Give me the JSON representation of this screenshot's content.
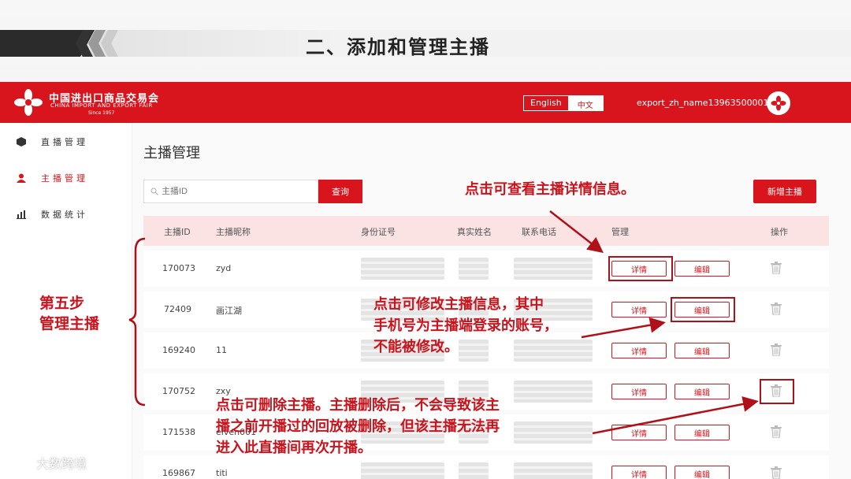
{
  "slide": {
    "title": "二、添加和管理主播"
  },
  "header": {
    "logo_cn": "中国进出口商品交易会",
    "logo_en": "CHINA IMPORT AND EXPORT FAIR",
    "logo_since": "Since 1957",
    "lang_en": "English",
    "lang_zh": "中文",
    "username": "export_zh_name13963500001"
  },
  "sidebar": {
    "items": [
      {
        "label": "直播管理",
        "icon": "cube-icon"
      },
      {
        "label": "主播管理",
        "icon": "user-icon",
        "active": true
      },
      {
        "label": "数据统计",
        "icon": "bar-chart-icon"
      }
    ]
  },
  "main": {
    "title": "主播管理",
    "search_placeholder": "主播ID",
    "query_label": "查询",
    "add_label": "新增主播",
    "columns": [
      "主播ID",
      "主播昵称",
      "身份证号",
      "真实姓名",
      "联系电话",
      "管理",
      "操作"
    ],
    "detail_label": "详情",
    "edit_label": "编辑",
    "rows": [
      {
        "id": "170073",
        "nickname": "zyd"
      },
      {
        "id": "72409",
        "nickname": "画江湖"
      },
      {
        "id": "169240",
        "nickname": "11"
      },
      {
        "id": "170752",
        "nickname": "zxy"
      },
      {
        "id": "171538",
        "nickname": "elven001"
      },
      {
        "id": "169867",
        "nickname": "titi"
      }
    ]
  },
  "annotations": {
    "detail_note": "点击可查看主播详情信息。",
    "edit_note_1": "点击可修改主播信息，其中",
    "edit_note_2": "手机号为主播端登录的账号，",
    "edit_note_3": "不能被修改。",
    "delete_note_1": "点击可删除主播。主播删除后，不会导致该主",
    "delete_note_2": "播之前开播过的回放被删除，但该主播无法再",
    "delete_note_3": "进入此直播间再次开播。",
    "step_1": "第五步",
    "step_2": "管理主播"
  },
  "watermark": "大数跨境",
  "colors": {
    "brand_red": "#d8141c",
    "annotation_red": "#c8141c",
    "header_row": "#fbe3e4"
  }
}
